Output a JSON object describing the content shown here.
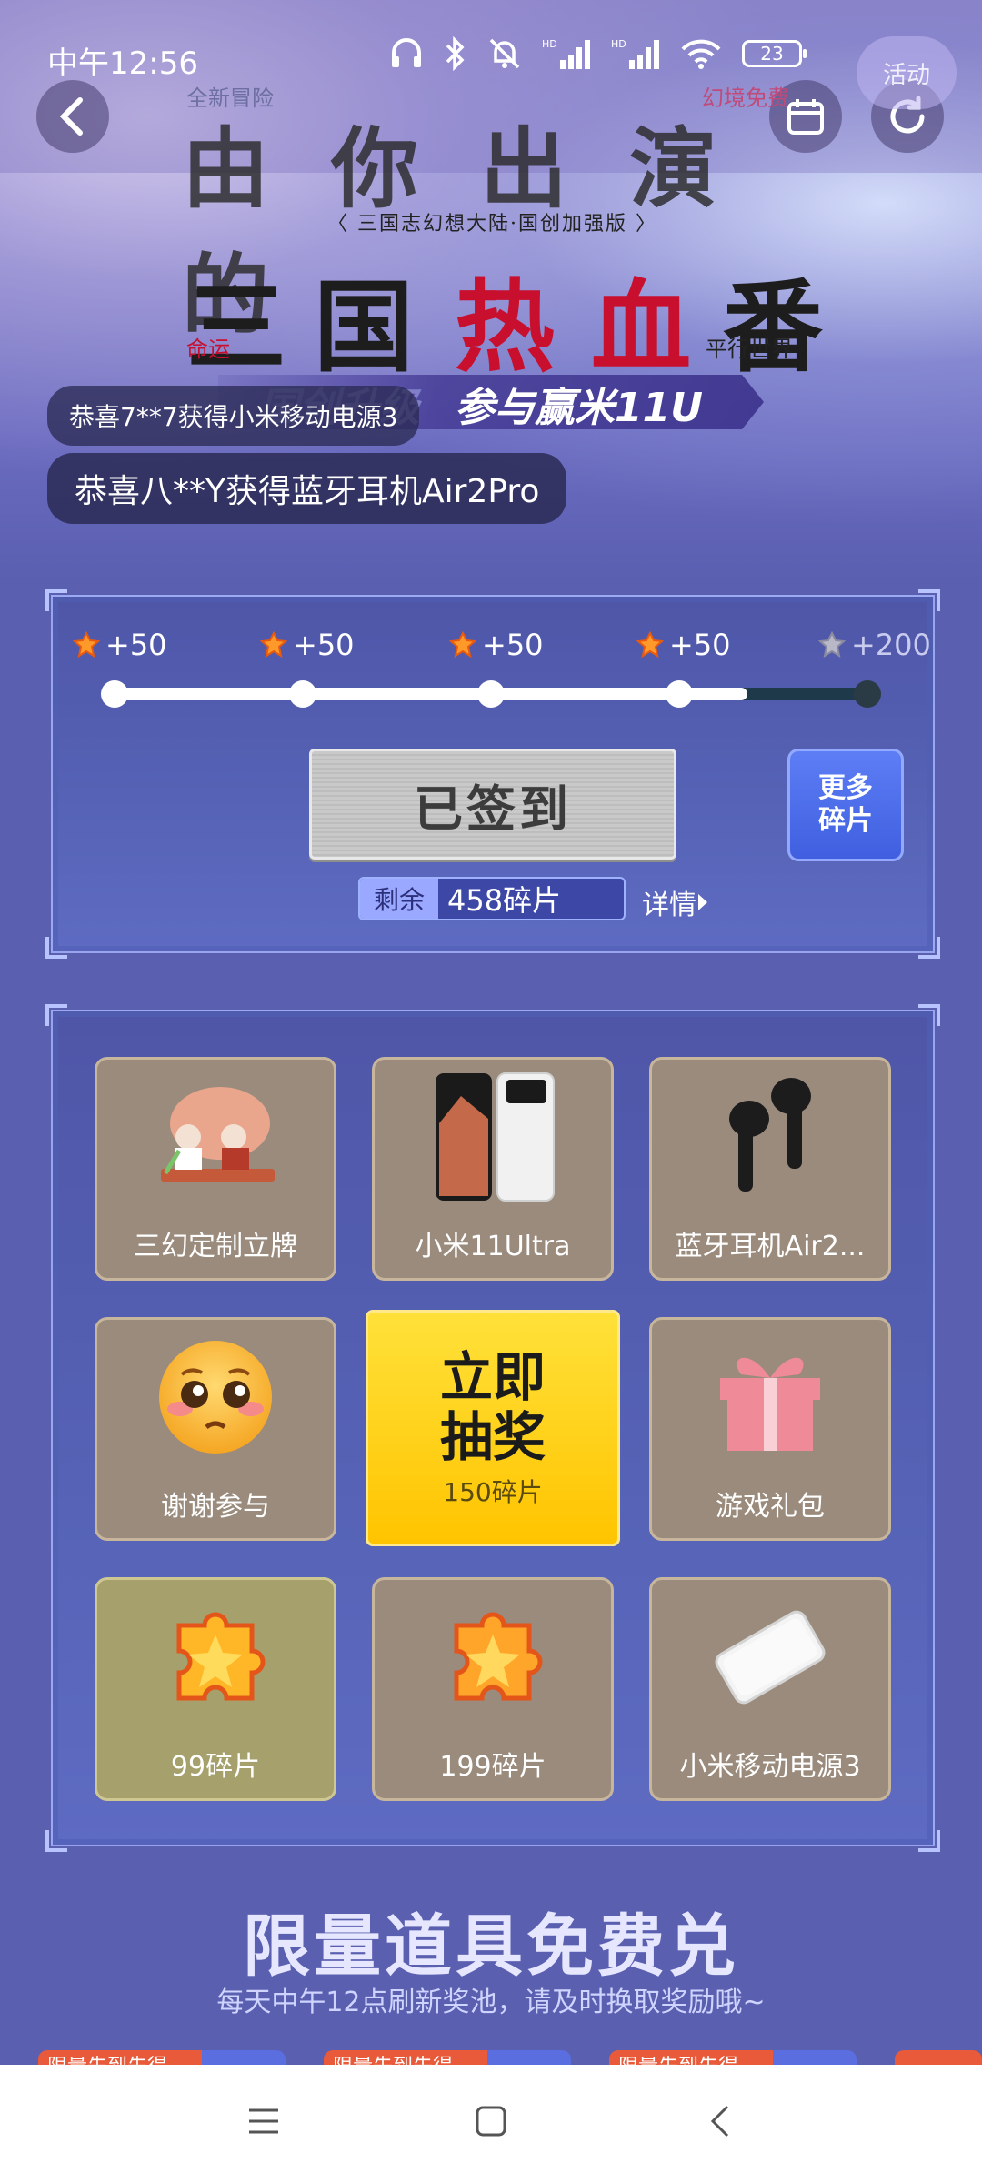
{
  "status_bar": {
    "time": "中午12:56",
    "battery": "23"
  },
  "header": {
    "tag_new_adventure": "全新冒险",
    "tag_fantasy": "幻境免费",
    "side_tab": "活动",
    "title_line": "由你出演的",
    "subtitle": "〈 三国志幻想大陆·国创加强版 〉",
    "sanguo_chars": [
      "三",
      "国",
      "热",
      "血",
      "番"
    ],
    "tag_fate": "命运",
    "tag_parallel": "平行世界",
    "banner_ghost": "国创升级",
    "banner_text": "参与赢米11U"
  },
  "toasts": {
    "first": "恭喜7**7获得小米移动电源3",
    "second": "恭喜八**Y获得蓝牙耳机Air2Pro"
  },
  "signin": {
    "rewards": [
      "+50",
      "+50",
      "+50",
      "+50",
      "+200"
    ],
    "progress_fraction": 0.84,
    "button_label": "已签到",
    "more_label_line1": "更多",
    "more_label_line2": "碎片",
    "remain_label": "剩余",
    "remain_value": "458碎片",
    "detail_label": "详情"
  },
  "lottery": {
    "tiles": [
      {
        "label": "三幻定制立牌",
        "icon": "standee-image"
      },
      {
        "label": "小米11Ultra",
        "icon": "phone-image"
      },
      {
        "label": "蓝牙耳机Air2...",
        "icon": "earbuds-image"
      },
      {
        "label": "谢谢参与",
        "icon": "pleading-face-icon"
      },
      {
        "label": "游戏礼包",
        "icon": "gift-box-icon"
      },
      {
        "label": "99碎片",
        "icon": "puzzle-piece-icon"
      },
      {
        "label": "199碎片",
        "icon": "puzzle-piece-icon"
      },
      {
        "label": "小米移动电源3",
        "icon": "power-bank-image"
      }
    ],
    "draw_line1": "立即",
    "draw_line2": "抽奖",
    "draw_cost": "150碎片"
  },
  "limited": {
    "title": "限量道具免费兑",
    "subtitle": "每天中午12点刷新奖池，请及时换取奖励哦~",
    "card_tag": "限量先到先得"
  },
  "colors": {
    "background": "#5a5fb0",
    "accent_red": "#c8102e",
    "draw_yellow": "#ffcc00"
  }
}
